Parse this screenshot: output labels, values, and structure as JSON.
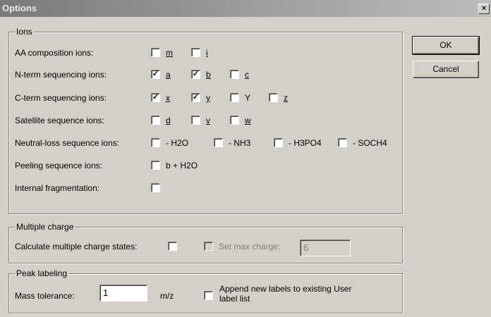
{
  "window": {
    "title": "Options",
    "close_glyph": "×"
  },
  "buttons": {
    "ok": "OK",
    "cancel": "Cancel"
  },
  "ions": {
    "legend": "Ions",
    "rows": [
      {
        "label": "AA composition ions:",
        "items": [
          {
            "text": "m",
            "checked": false
          },
          {
            "text": "i",
            "checked": false
          }
        ]
      },
      {
        "label": "N-term sequencing ions:",
        "items": [
          {
            "text": "a",
            "checked": true
          },
          {
            "text": "b",
            "checked": true
          },
          {
            "text": "c",
            "checked": false
          }
        ]
      },
      {
        "label": "C-term sequencing ions:",
        "items": [
          {
            "text": "x",
            "checked": true
          },
          {
            "text": "y",
            "checked": true
          },
          {
            "text": "Y",
            "checked": false
          },
          {
            "text": "z",
            "checked": false
          }
        ]
      },
      {
        "label": "Satellite sequence ions:",
        "items": [
          {
            "text": "d",
            "checked": false
          },
          {
            "text": "v",
            "checked": false
          },
          {
            "text": "w",
            "checked": false
          }
        ]
      },
      {
        "label": "Neutral-loss sequence ions:",
        "items": [
          {
            "text": "- H2O",
            "checked": false
          },
          {
            "text": "- NH3",
            "checked": false
          },
          {
            "text": "- H3PO4",
            "checked": false
          },
          {
            "text": "- SOCH4",
            "checked": false
          }
        ]
      },
      {
        "label": "Peeling sequence ions:",
        "items": [
          {
            "text": "b + H2O",
            "checked": false
          }
        ]
      },
      {
        "label": "Internal fragmentation:",
        "items": [
          {
            "text": "",
            "checked": false
          }
        ]
      }
    ]
  },
  "multiple_charge": {
    "legend": "Multiple charge",
    "calc_label": "Calculate multiple charge states:",
    "set_max_label": "Set max charge:",
    "max_value": "6"
  },
  "peak_labeling": {
    "legend": "Peak labeling",
    "tolerance_label": "Mass tolerance:",
    "tolerance_value": "1",
    "unit": "m/z",
    "append_label_1": "Append new labels to existing User",
    "append_label_2": "label list"
  }
}
